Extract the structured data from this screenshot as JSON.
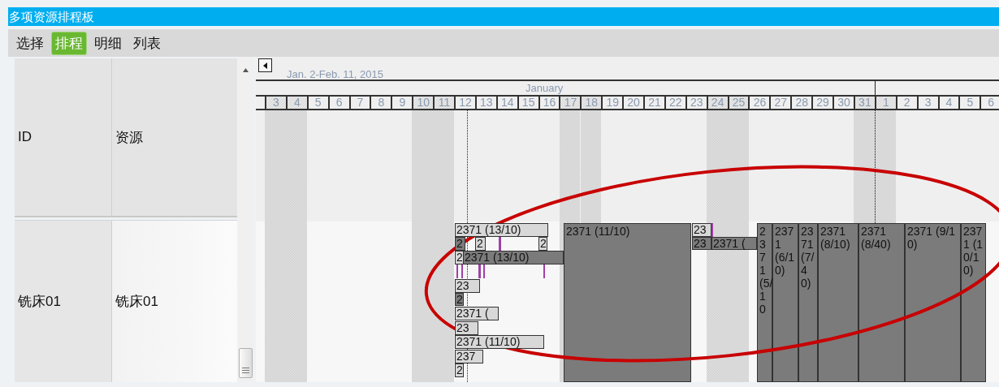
{
  "window": {
    "title": "多项资源排程板"
  },
  "tabs": [
    {
      "label": "选择",
      "selected": false
    },
    {
      "label": "排程",
      "selected": true
    },
    {
      "label": "明细",
      "selected": false
    },
    {
      "label": "列表",
      "selected": false
    }
  ],
  "resource_table": {
    "columns": [
      "ID",
      "资源"
    ],
    "rows": [
      {
        "id": "铣床01",
        "resource": "铣床01"
      }
    ]
  },
  "gantt": {
    "range": "Jan. 2-Feb. 11, 2015",
    "month": "January",
    "days": [
      {
        "label": "3",
        "weekend": true
      },
      {
        "label": "4",
        "weekend": true
      },
      {
        "label": "5",
        "weekend": false
      },
      {
        "label": "6",
        "weekend": false
      },
      {
        "label": "7",
        "weekend": false
      },
      {
        "label": "8",
        "weekend": false
      },
      {
        "label": "9",
        "weekend": false
      },
      {
        "label": "10",
        "weekend": true
      },
      {
        "label": "11",
        "weekend": true
      },
      {
        "label": "12",
        "weekend": false
      },
      {
        "label": "13",
        "weekend": false
      },
      {
        "label": "14",
        "weekend": false
      },
      {
        "label": "15",
        "weekend": false
      },
      {
        "label": "16",
        "weekend": false
      },
      {
        "label": "17",
        "weekend": true
      },
      {
        "label": "18",
        "weekend": true
      },
      {
        "label": "19",
        "weekend": false
      },
      {
        "label": "20",
        "weekend": false
      },
      {
        "label": "21",
        "weekend": false
      },
      {
        "label": "22",
        "weekend": false
      },
      {
        "label": "23",
        "weekend": false
      },
      {
        "label": "24",
        "weekend": true
      },
      {
        "label": "25",
        "weekend": true
      },
      {
        "label": "26",
        "weekend": false
      },
      {
        "label": "27",
        "weekend": false
      },
      {
        "label": "28",
        "weekend": false
      },
      {
        "label": "29",
        "weekend": false
      },
      {
        "label": "30",
        "weekend": false
      },
      {
        "label": "31",
        "weekend": true
      },
      {
        "label": "1",
        "weekend": true
      },
      {
        "label": "2",
        "weekend": false
      },
      {
        "label": "3",
        "weekend": false
      },
      {
        "label": "4",
        "weekend": false
      },
      {
        "label": "5",
        "weekend": false
      },
      {
        "label": "6",
        "weekend": false
      }
    ],
    "tasks": [
      {
        "label": "2371 (13/10)",
        "kind": "light"
      },
      {
        "label": "2",
        "kind": "dark"
      },
      {
        "label": "2",
        "kind": "light"
      },
      {
        "label": "2",
        "kind": "light"
      },
      {
        "label": "2",
        "kind": "light"
      },
      {
        "label": "2371 (13/10)",
        "kind": "dark"
      },
      {
        "label": "23",
        "kind": "light"
      },
      {
        "label": "2",
        "kind": "dark"
      },
      {
        "label": "2371 (",
        "kind": "light"
      },
      {
        "label": "23",
        "kind": "light"
      },
      {
        "label": "2371 (11/10)",
        "kind": "light"
      },
      {
        "label": "237",
        "kind": "light"
      },
      {
        "label": "2",
        "kind": "light"
      },
      {
        "label": "2371 (11/10)",
        "kind": "dark"
      },
      {
        "label": "23",
        "kind": "light"
      },
      {
        "label": "23",
        "kind": "dark"
      },
      {
        "label": "2371 (",
        "kind": "dark"
      },
      {
        "label": "2371 (5/10",
        "kind": "dark"
      },
      {
        "label": "2371 (6/10)",
        "kind": "dark"
      },
      {
        "label": "2371 (7/40)",
        "kind": "dark"
      },
      {
        "label": "2371 (8/10)",
        "kind": "dark"
      },
      {
        "label": "2371 (8/40)",
        "kind": "dark"
      },
      {
        "label": "2371 (9/10)",
        "kind": "dark"
      },
      {
        "label": "2371 (10/10)",
        "kind": "dark"
      }
    ]
  }
}
